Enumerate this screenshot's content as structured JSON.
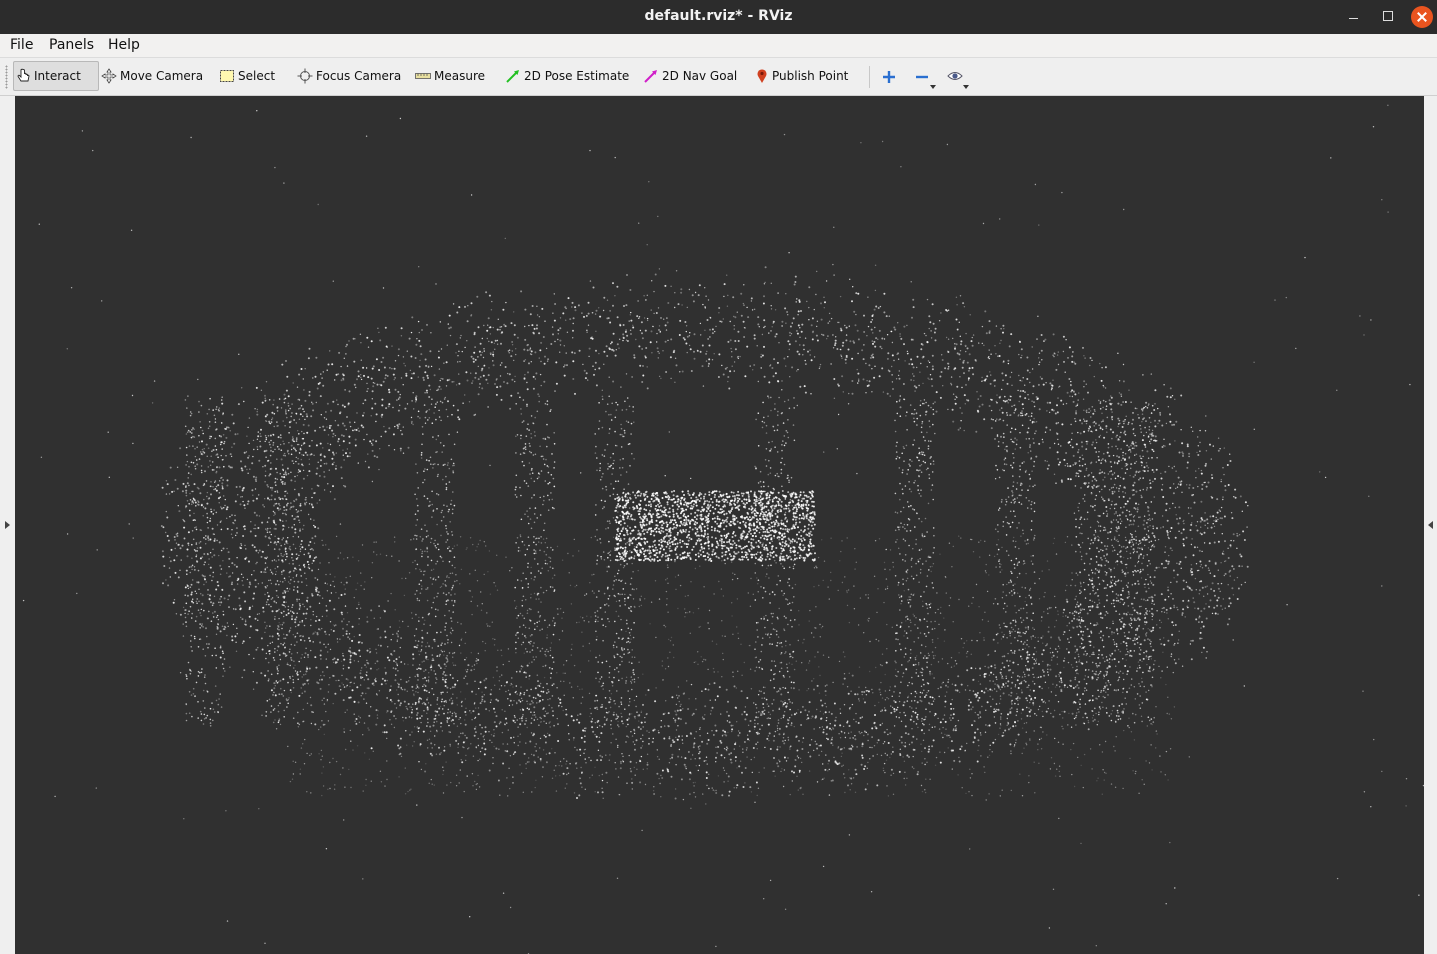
{
  "window": {
    "title": "default.rviz* - RViz"
  },
  "menu": {
    "file": "File",
    "panels": "Panels",
    "help": "Help"
  },
  "toolbar": {
    "tools": [
      {
        "id": "interact",
        "label": "Interact",
        "icon": "hand-pointer-icon",
        "active": true
      },
      {
        "id": "move-camera",
        "label": "Move Camera",
        "icon": "move-arrows-icon"
      },
      {
        "id": "select",
        "label": "Select",
        "icon": "selection-box-icon"
      },
      {
        "id": "focus-camera",
        "label": "Focus Camera",
        "icon": "crosshair-icon"
      },
      {
        "id": "measure",
        "label": "Measure",
        "icon": "ruler-icon"
      },
      {
        "id": "2d-pose-estimate",
        "label": "2D Pose Estimate",
        "icon": "green-arrow-icon"
      },
      {
        "id": "2d-nav-goal",
        "label": "2D Nav Goal",
        "icon": "magenta-arrow-icon"
      },
      {
        "id": "publish-point",
        "label": "Publish Point",
        "icon": "map-pin-icon"
      }
    ],
    "extras": [
      "add-tool-icon",
      "remove-tool-icon",
      "eye-visibility-icon"
    ]
  },
  "viewport": {
    "content": "3D point cloud render",
    "background_color": "#303030",
    "point_color": "#ffffff"
  },
  "colors": {
    "titlebar": "#2c2c2c",
    "close_button": "#e9541f",
    "pose_estimate_arrow": "#22c022",
    "nav_goal_arrow": "#d020c8",
    "publish_point_pin": "#d04020",
    "add_tool": "#2a6fd0"
  }
}
